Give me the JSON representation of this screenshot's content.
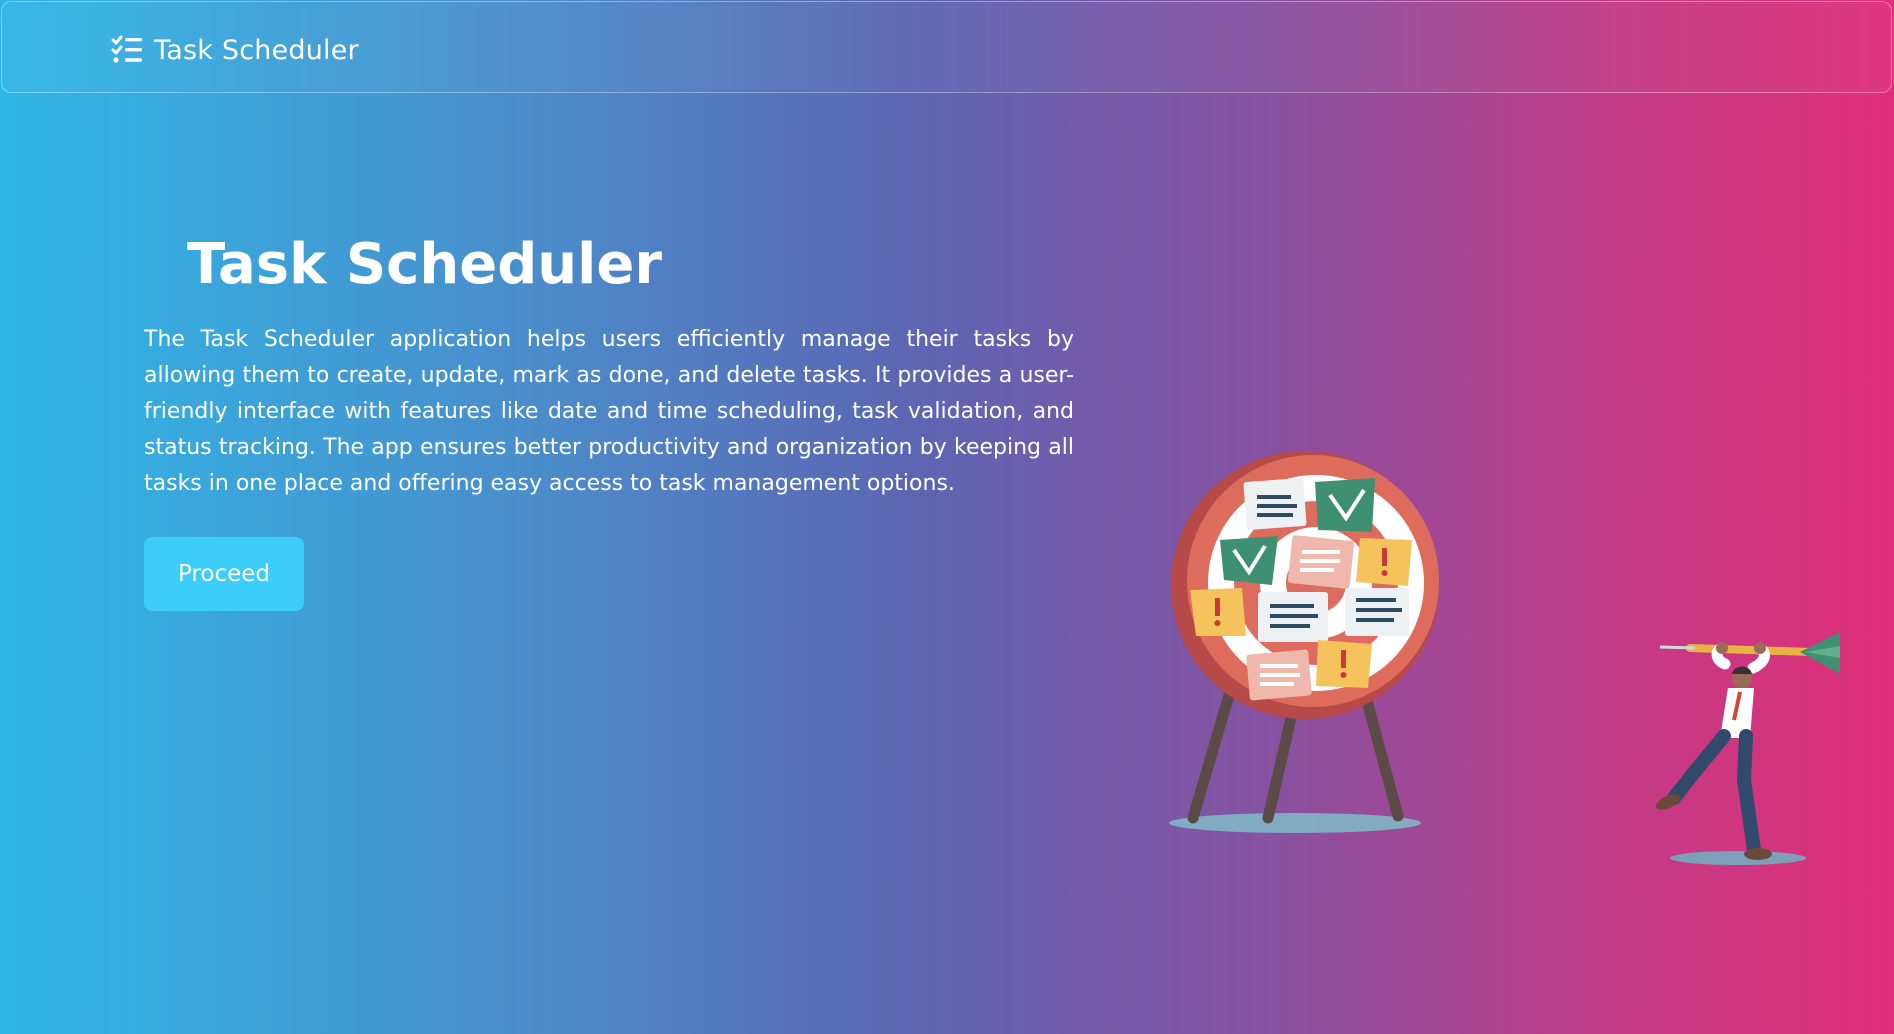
{
  "navbar": {
    "brand_icon": "checklist-icon",
    "brand_title": "Task Scheduler"
  },
  "hero": {
    "title": "Task Scheduler",
    "description": "The Task Scheduler application helps users efficiently manage their tasks by allowing them to create, update, mark as done, and delete tasks. It provides a user-friendly interface with features like date and time scheduling, task validation, and status tracking. The app ensures better productivity and organization by keeping all tasks in one place and offering easy access to task management options.",
    "proceed_label": "Proceed"
  },
  "illustration": {
    "name": "dartboard-with-task-notes-and-man-throwing-dart"
  },
  "colors": {
    "gradient_left": "#2fb6e6",
    "gradient_mid": "#5c66b3",
    "gradient_right": "#e02e78",
    "button": "#3ccdfb",
    "text": "#ffffff"
  }
}
